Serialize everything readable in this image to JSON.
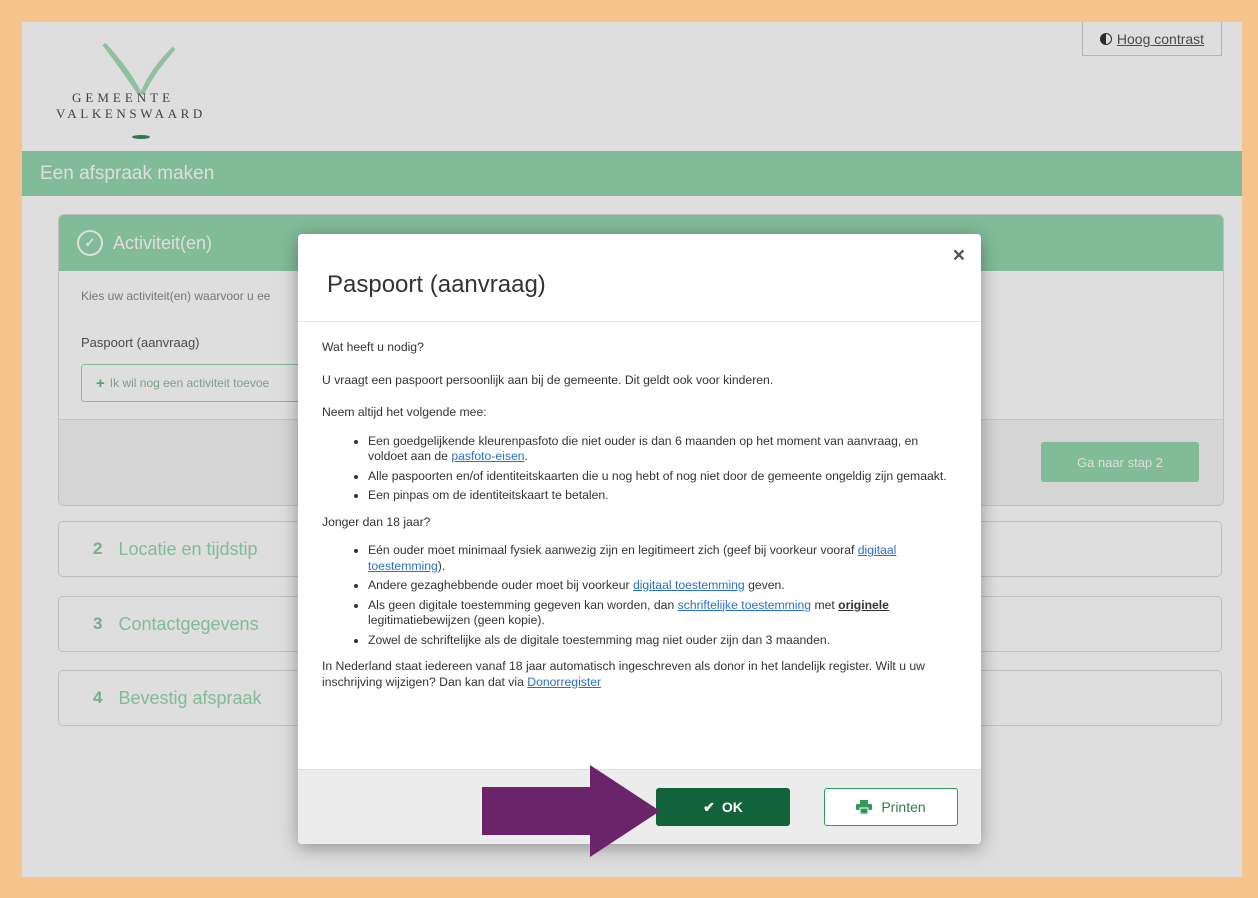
{
  "header": {
    "logo_line1": "GEMEENTE",
    "logo_line2": "VALKENSWAARD",
    "contrast_label": "Hoog contrast"
  },
  "page_title": "Een afspraak maken",
  "step1": {
    "title": "Activiteit(en)",
    "hint": "Kies uw activiteit(en) waarvoor u ee",
    "activity": "Paspoort (aanvraag)",
    "add_label": "Ik wil nog een activiteit toevoe",
    "next_label": "Ga naar stap 2"
  },
  "steps": [
    {
      "num": "2",
      "label": "Locatie en tijdstip"
    },
    {
      "num": "3",
      "label": "Contactgegevens"
    },
    {
      "num": "4",
      "label": "Bevestig afspraak"
    }
  ],
  "modal": {
    "title": "Paspoort (aanvraag)",
    "close": "×",
    "q1": "Wat heeft u nodig?",
    "p1": "U vraagt een paspoort persoonlijk aan bij de gemeente. Dit geldt ook voor kinderen.",
    "p2": "Neem altijd het volgende mee:",
    "li1_a": "Een goedgelijkende kleurenpasfoto die niet ouder is dan 6 maanden op het moment van aanvraag, en voldoet aan de ",
    "li1_link": "pasfoto-eisen",
    "li1_b": ".",
    "li2": "Alle paspoorten en/of identiteitskaarten die u nog hebt of nog niet door de gemeente ongeldig zijn gemaakt.",
    "li3": "Een pinpas om de identiteitskaart te betalen.",
    "q2": "Jonger dan 18 jaar?",
    "li4_a": "Eén ouder moet minimaal fysiek aanwezig zijn en legitimeert zich (geef bij voorkeur vooraf ",
    "li4_link": "digitaal toestemming",
    "li4_b": ").",
    "li5_a": "Andere gezaghebbende ouder moet bij voorkeur ",
    "li5_link": "digitaal toestemming",
    "li5_b": " geven.",
    "li6_a": "Als geen digitale toestemming gegeven kan worden, dan ",
    "li6_link": "schriftelijke toestemming",
    "li6_b": " met ",
    "li6_strong": "originele",
    "li6_c": " legitimatiebewijzen (geen kopie).",
    "li7": "Zowel de schriftelijke als de digitale toestemming mag niet ouder zijn dan 3 maanden.",
    "p3_a": "In Nederland staat iedereen vanaf 18 jaar automatisch ingeschreven als donor in het landelijk register. Wilt u uw inschrijving wijzigen? Dan kan dat via ",
    "p3_link": "Donorregister",
    "ok_label": "OK",
    "print_label": "Printen"
  },
  "colors": {
    "frame": "#f6c48c",
    "brand_green": "#96d7ae",
    "ok_green": "#12623a",
    "arrow": "#6b2469"
  }
}
